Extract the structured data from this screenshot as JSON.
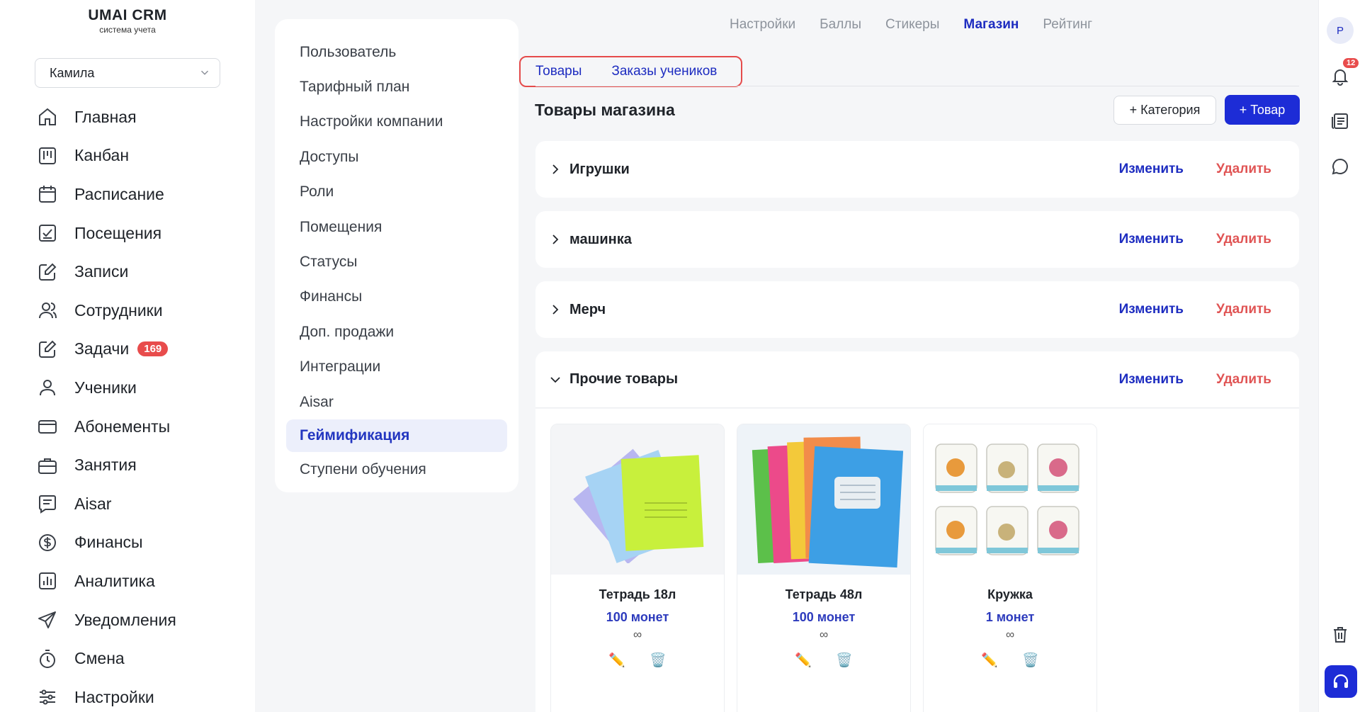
{
  "app": {
    "title": "UMAI CRM",
    "subtitle": "система учета"
  },
  "user_select": {
    "value": "Камила"
  },
  "nav": [
    {
      "label": "Главная",
      "icon": "home-icon"
    },
    {
      "label": "Канбан",
      "icon": "kanban-icon"
    },
    {
      "label": "Расписание",
      "icon": "calendar-icon"
    },
    {
      "label": "Посещения",
      "icon": "attendance-icon"
    },
    {
      "label": "Записи",
      "icon": "edit-note-icon"
    },
    {
      "label": "Сотрудники",
      "icon": "staff-icon"
    },
    {
      "label": "Задачи",
      "icon": "tasks-icon",
      "badge": "169"
    },
    {
      "label": "Ученики",
      "icon": "user-icon"
    },
    {
      "label": "Абонементы",
      "icon": "card-icon"
    },
    {
      "label": "Занятия",
      "icon": "briefcase-icon"
    },
    {
      "label": "Aisar",
      "icon": "chat-list-icon"
    },
    {
      "label": "Финансы",
      "icon": "dollar-icon"
    },
    {
      "label": "Аналитика",
      "icon": "analytics-icon"
    },
    {
      "label": "Уведомления",
      "icon": "send-icon"
    },
    {
      "label": "Смена",
      "icon": "timer-icon"
    },
    {
      "label": "Настройки",
      "icon": "sliders-icon"
    }
  ],
  "settings_menu": [
    "Пользователь",
    "Тарифный план",
    "Настройки компании",
    "Доступы",
    "Роли",
    "Помещения",
    "Статусы",
    "Финансы",
    "Доп. продажи",
    "Интеграции",
    "Aisar",
    "Геймификация",
    "Ступени обучения"
  ],
  "settings_menu_active": "Геймификация",
  "top_tabs": [
    "Настройки",
    "Баллы",
    "Стикеры",
    "Магазин",
    "Рейтинг"
  ],
  "top_tab_active": "Магазин",
  "sub_tabs": [
    "Товары",
    "Заказы учеников"
  ],
  "page_title": "Товары магазина",
  "buttons": {
    "add_category": "+ Категория",
    "add_product": "+ Товар"
  },
  "categories": [
    {
      "name": "Игрушки",
      "expanded": false
    },
    {
      "name": "машинка",
      "expanded": false
    },
    {
      "name": "Мерч",
      "expanded": false
    },
    {
      "name": "Прочие товары",
      "expanded": true
    }
  ],
  "category_actions": {
    "edit": "Изменить",
    "delete": "Удалить"
  },
  "products": [
    {
      "name": "Тетрадь 18л",
      "price": "100 монет",
      "stock": "∞"
    },
    {
      "name": "Тетрадь 48л",
      "price": "100 монет",
      "stock": "∞"
    },
    {
      "name": "Кружка",
      "price": "1 монет",
      "stock": "∞"
    }
  ],
  "right_rail": {
    "avatar": "Р",
    "notifications": "12"
  },
  "colors": {
    "accent": "#1d2cd6",
    "danger": "#e05454",
    "badge": "#e84c4c"
  }
}
